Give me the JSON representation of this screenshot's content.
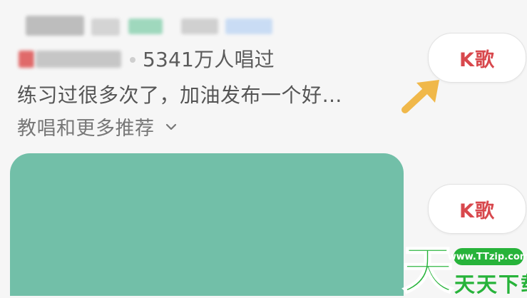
{
  "song": {
    "stats_text": "5341万人唱过",
    "subtitle": "练习过很多次了，加油发布一个好…",
    "more_label": "教唱和更多推荐"
  },
  "buttons": {
    "kge_label_1": "K歌",
    "kge_label_2": "K歌"
  },
  "watermark": {
    "url": "www.TTzip.com",
    "name": "天天下载",
    "logo_char": "天"
  },
  "colors": {
    "accent_red": "#d8484d",
    "cover_green": "#72bfa8",
    "arrow_yellow": "#f0b84a",
    "watermark_green": "#27b33a"
  },
  "icons": {
    "chevron": "chevron-down-icon",
    "arrow": "arrow-pointer-icon"
  }
}
